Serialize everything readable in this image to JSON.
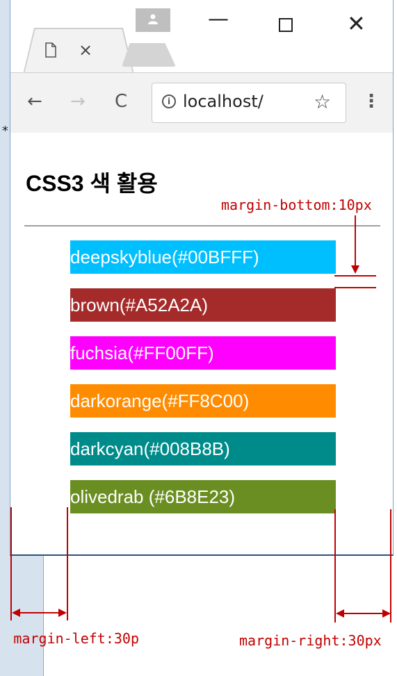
{
  "browser": {
    "tab": {
      "close_label": "×"
    },
    "toolbar": {
      "back_label": "←",
      "forward_label": "→",
      "reload_label": "C",
      "url": "localhost/",
      "info_label": "i",
      "star_label": "☆",
      "menu_label": "⋮"
    },
    "window_controls": {
      "minimize_label": "—",
      "close_label": "✕"
    }
  },
  "background": {
    "star_label": "*"
  },
  "page": {
    "title": "CSS3 색 활용",
    "items": [
      {
        "label": "deepskyblue(#00BFFF)",
        "color": "#00BFFF"
      },
      {
        "label": "brown(#A52A2A)",
        "color": "#A52A2A"
      },
      {
        "label": "fuchsia(#FF00FF)",
        "color": "#FF00FF"
      },
      {
        "label": "darkorange(#FF8C00)",
        "color": "#FF8C00"
      },
      {
        "label": "darkcyan(#008B8B)",
        "color": "#008B8B"
      },
      {
        "label": "olivedrab (#6B8E23)",
        "color": "#6B8E23"
      }
    ]
  },
  "annotations": {
    "margin_bottom": "margin-bottom:10px",
    "margin_left": "margin-left:30p",
    "margin_right": "margin-right:30px",
    "color": "#C00000"
  }
}
